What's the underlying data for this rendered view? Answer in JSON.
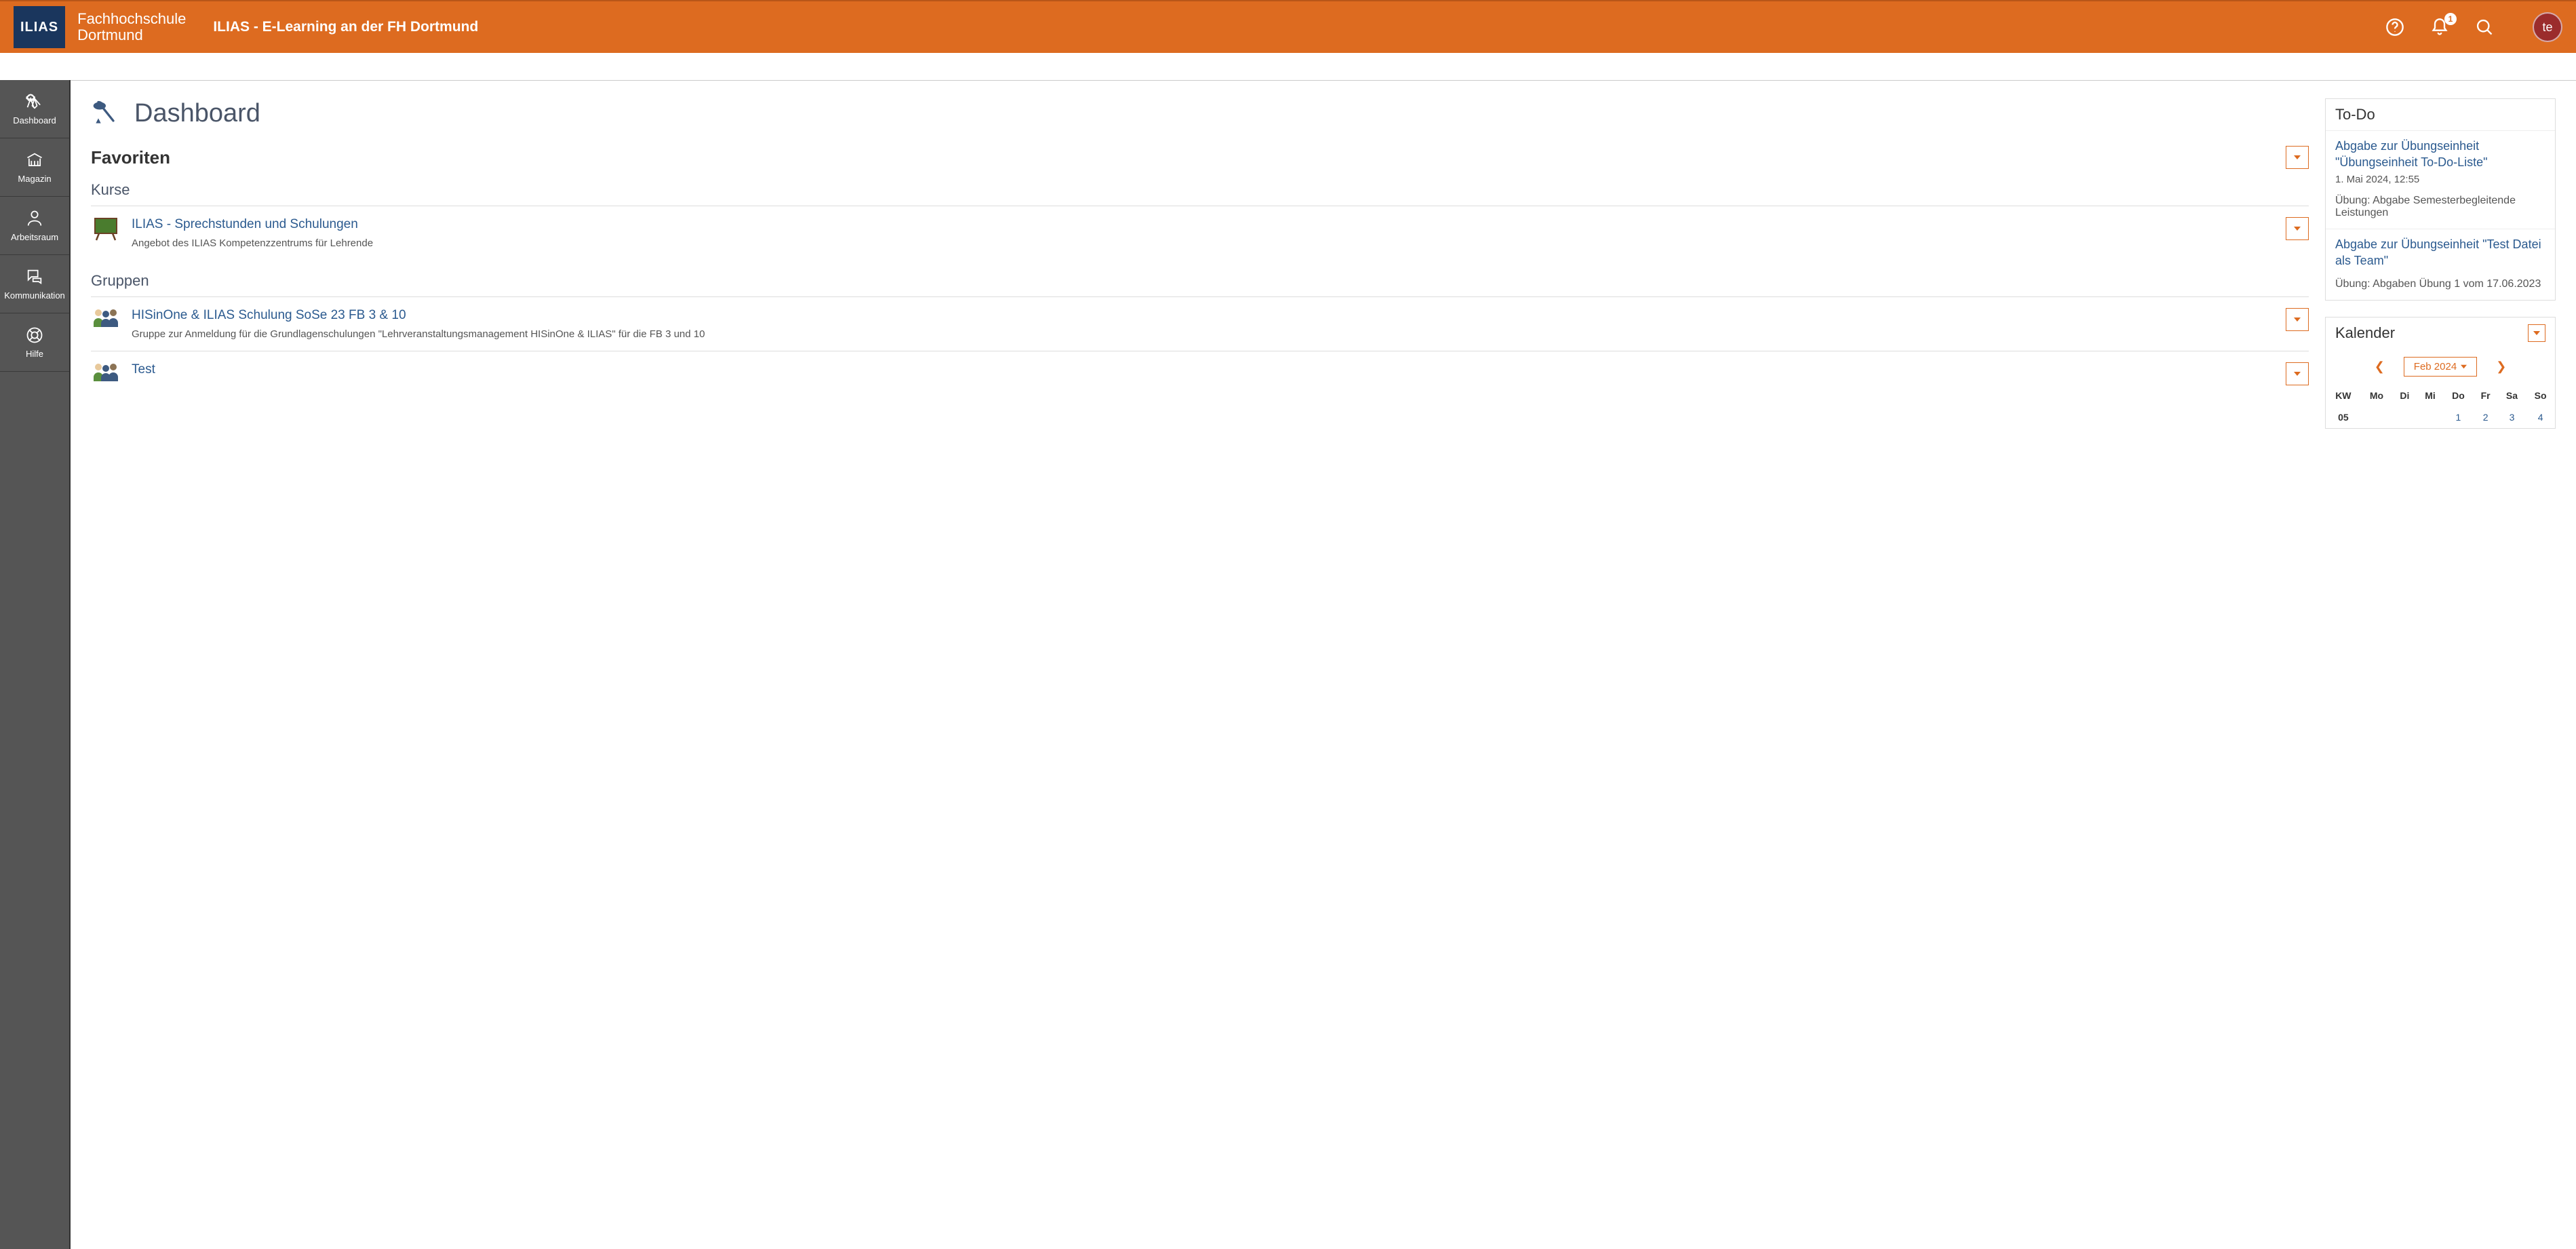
{
  "header": {
    "logo_text": "ILIAS",
    "institution_line1": "Fachhochschule",
    "institution_line2": "Dortmund",
    "title": "ILIAS - E-Learning an der FH Dortmund",
    "notification_count": "1",
    "avatar_initials": "te"
  },
  "sidebar": {
    "items": [
      {
        "label": "Dashboard"
      },
      {
        "label": "Magazin"
      },
      {
        "label": "Arbeitsraum"
      },
      {
        "label": "Kommunikation"
      },
      {
        "label": "Hilfe"
      }
    ]
  },
  "page": {
    "title": "Dashboard"
  },
  "favorites": {
    "heading": "Favoriten",
    "groups": [
      {
        "heading": "Kurse",
        "items": [
          {
            "title": "ILIAS - Sprechstunden und Schulungen",
            "desc": "Angebot des ILIAS Kompetenzzentrums für Lehrende",
            "icon": "course"
          }
        ]
      },
      {
        "heading": "Gruppen",
        "items": [
          {
            "title": "HISinOne & ILIAS Schulung SoSe 23 FB 3 & 10",
            "desc": "Gruppe zur Anmeldung für die Grundlagenschulungen \"Lehrveranstaltungsmanagement HISinOne & ILIAS\" für die FB 3 und 10",
            "icon": "group"
          },
          {
            "title": "Test",
            "desc": "",
            "icon": "group"
          }
        ]
      }
    ]
  },
  "todo": {
    "heading": "To-Do",
    "items": [
      {
        "link": "Abgabe zur Übungseinheit \"Übungseinheit To-Do-Liste\"",
        "date": "1. Mai 2024, 12:55",
        "meta_label": "Übung:",
        "meta_value": "Abgabe Semesterbegleitende Leistungen"
      },
      {
        "link": "Abgabe zur Übungseinheit \"Test Datei als Team\"",
        "date": "",
        "meta_label": "Übung:",
        "meta_value": "Abgaben Übung 1 vom 17.06.2023"
      }
    ]
  },
  "calendar": {
    "heading": "Kalender",
    "month_label": "Feb 2024",
    "weekdays": [
      "KW",
      "Mo",
      "Di",
      "Mi",
      "Do",
      "Fr",
      "Sa",
      "So"
    ],
    "rows": [
      {
        "kw": "05",
        "days": [
          "",
          "",
          "",
          "1",
          "2",
          "3",
          "4"
        ]
      }
    ]
  }
}
